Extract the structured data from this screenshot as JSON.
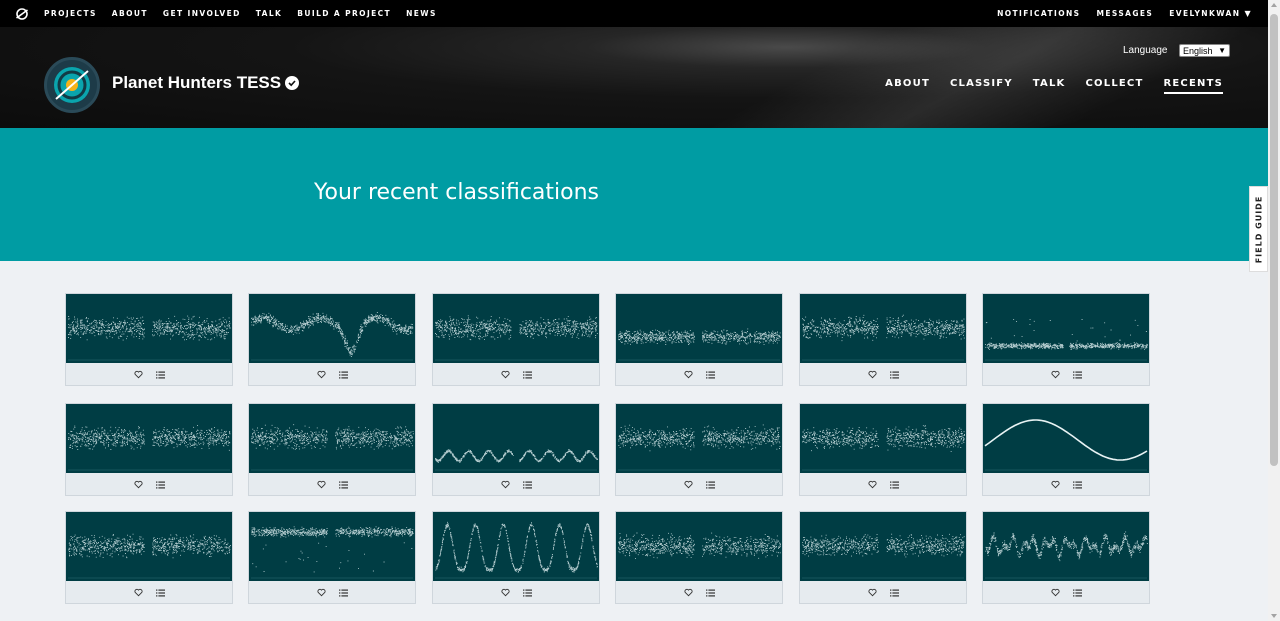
{
  "topnav": {
    "links": [
      "PROJECTS",
      "ABOUT",
      "GET INVOLVED",
      "TALK",
      "BUILD A PROJECT",
      "NEWS"
    ],
    "notifications": "NOTIFICATIONS",
    "messages": "MESSAGES",
    "user": "EVELYNKWAN"
  },
  "project": {
    "title": "Planet Hunters TESS",
    "language_label": "Language",
    "language_value": "English",
    "nav": [
      "ABOUT",
      "CLASSIFY",
      "TALK",
      "COLLECT",
      "RECENTS"
    ],
    "active_nav": "RECENTS"
  },
  "banner": {
    "title": "Your recent classifications"
  },
  "field_guide": "FIELD GUIDE",
  "colors": {
    "teal": "#009ca3",
    "thumb_bg": "#003d44",
    "accent": "#ffffff"
  },
  "icons": {
    "favorite": "heart-icon",
    "collect": "list-icon"
  },
  "cards": [
    {
      "pattern": "noise-gap"
    },
    {
      "pattern": "wavy-dip"
    },
    {
      "pattern": "noise-gap"
    },
    {
      "pattern": "flat-gap"
    },
    {
      "pattern": "noise-gap"
    },
    {
      "pattern": "flat-band"
    },
    {
      "pattern": "noise-gap"
    },
    {
      "pattern": "noise-gap"
    },
    {
      "pattern": "oscillation"
    },
    {
      "pattern": "noise-gap"
    },
    {
      "pattern": "noise-gap"
    },
    {
      "pattern": "smooth-curve"
    },
    {
      "pattern": "noise-gap"
    },
    {
      "pattern": "dip-spikes"
    },
    {
      "pattern": "peaks"
    },
    {
      "pattern": "noise-gap"
    },
    {
      "pattern": "noise-gap"
    },
    {
      "pattern": "jagged"
    }
  ]
}
